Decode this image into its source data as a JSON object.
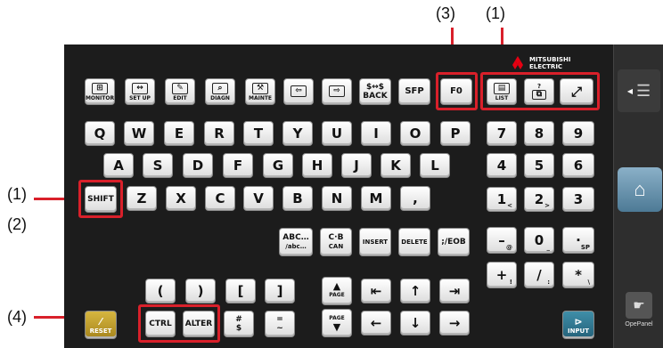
{
  "callouts": {
    "c1_top": "(1)",
    "c3_top": "(3)",
    "c1_left": "(1)",
    "c2_left": "(2)",
    "c4_left": "(4)"
  },
  "brand": {
    "line1": "MITSUBISHI",
    "line2": "ELECTRIC"
  },
  "function_keys": [
    {
      "label": "MONITOR",
      "icon": "monitor-icon"
    },
    {
      "label": "SET UP",
      "icon": "setup-icon"
    },
    {
      "label": "EDIT",
      "icon": "edit-icon"
    },
    {
      "label": "DIAGN",
      "icon": "diagnosis-icon"
    },
    {
      "label": "MAINTE",
      "icon": "maintenance-icon"
    },
    {
      "label": "",
      "icon": "page-back-icon"
    },
    {
      "label": "",
      "icon": "page-forward-icon"
    }
  ],
  "keys": {
    "back_top": "$↔$",
    "back": "BACK",
    "sfp": "SFP",
    "f0": "F0",
    "list": "LIST",
    "window_q": "?",
    "row1": [
      "Q",
      "W",
      "E",
      "R",
      "T",
      "Y",
      "U",
      "I",
      "O",
      "P"
    ],
    "row2": [
      "A",
      "S",
      "D",
      "F",
      "G",
      "H",
      "J",
      "K",
      "L"
    ],
    "shift": "SHIFT",
    "row3": [
      "Z",
      "X",
      "C",
      "V",
      "B",
      "N",
      "M",
      ","
    ],
    "abc_1": "ABC…",
    "abc_2": "/abc…",
    "cb_1": "C·B",
    "cb_2": "CAN",
    "insert": "INSERT",
    "delete": "DELETE",
    "eob": ";/EOB",
    "brackets": [
      "(",
      ")",
      "[",
      "]"
    ],
    "page": "PAGE",
    "reset": "RESET",
    "ctrl": "CTRL",
    "alter": "ALTER",
    "hash_1": "#",
    "hash_2": "$",
    "eq_1": "=",
    "eq_2": "~",
    "num": [
      [
        "7",
        ""
      ],
      [
        "8",
        ""
      ],
      [
        "9",
        ""
      ],
      [
        "4",
        ""
      ],
      [
        "5",
        ""
      ],
      [
        "6",
        ""
      ],
      [
        "1",
        "<"
      ],
      [
        "2",
        ">"
      ],
      [
        "3",
        ""
      ],
      [
        "–",
        "@"
      ],
      [
        "0",
        "_"
      ],
      [
        "·",
        "SP"
      ],
      [
        "+",
        "!"
      ],
      [
        "/",
        ":"
      ],
      [
        "*",
        "\\"
      ]
    ],
    "input": "INPUT"
  },
  "sidebar": {
    "opepanel": "OpePanel"
  },
  "colors": {
    "highlight": "#d9202a",
    "panel": "#1c1c1c",
    "reset": "#c9a52e",
    "input": "#2f7a94"
  }
}
